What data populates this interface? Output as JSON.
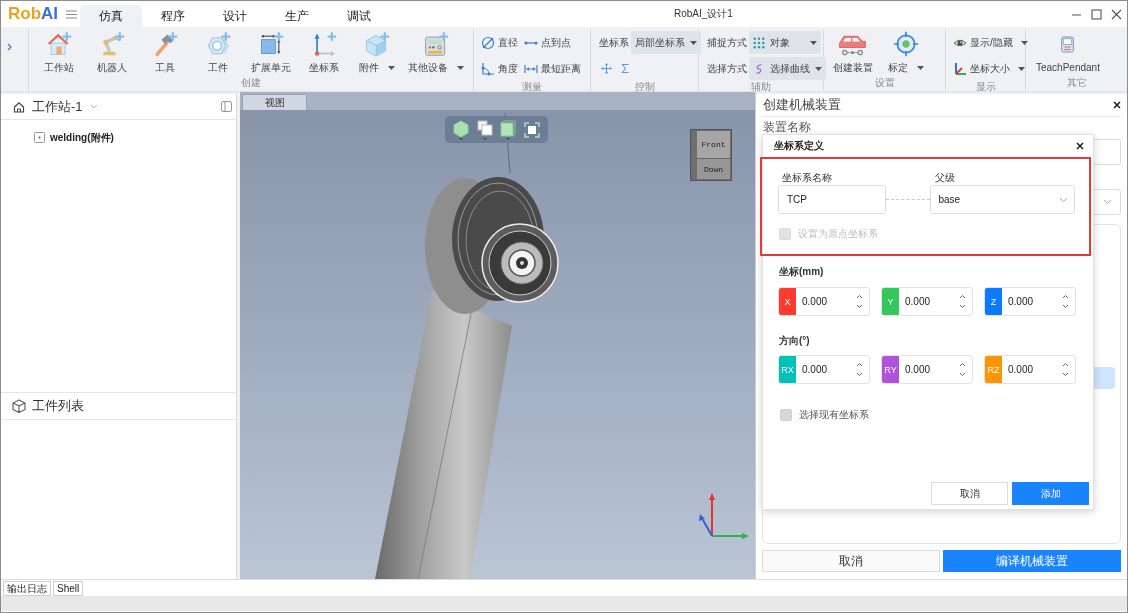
{
  "logo": {
    "parts": [
      {
        "text": "Rob",
        "color": "#e8a21c"
      },
      {
        "text": "AI",
        "color": "#3a70d6"
      }
    ]
  },
  "tabs": [
    {
      "label": "仿真",
      "selected": true
    },
    {
      "label": "程序",
      "selected": false
    },
    {
      "label": "设计",
      "selected": false
    },
    {
      "label": "生产",
      "selected": false
    },
    {
      "label": "调试",
      "selected": false
    }
  ],
  "window": {
    "title": "RobAI_设计1"
  },
  "ribbon": {
    "groups": [
      {
        "label": "创建",
        "kind": "row",
        "items": [
          {
            "kind": "large",
            "label": "工作站",
            "dropdown": false
          },
          {
            "kind": "large",
            "label": "机器人",
            "dropdown": false
          },
          {
            "kind": "large",
            "label": "工具",
            "dropdown": false
          },
          {
            "kind": "large",
            "label": "工件",
            "dropdown": false
          },
          {
            "kind": "large",
            "label": "扩展单元",
            "dropdown": false
          },
          {
            "kind": "large",
            "label": "坐标系",
            "dropdown": false
          },
          {
            "kind": "large",
            "label": "附件",
            "dropdown": true
          },
          {
            "kind": "large",
            "label": "其他设备",
            "dropdown": true
          }
        ]
      },
      {
        "label": "测量",
        "kind": "grid",
        "items": [
          {
            "kind": "small",
            "label": "直径",
            "dropdown": false
          },
          {
            "kind": "small",
            "label": "点到点",
            "dropdown": false
          },
          {
            "kind": "small",
            "label": "角度",
            "dropdown": false
          },
          {
            "kind": "small",
            "label": "最短距离",
            "dropdown": false
          }
        ]
      },
      {
        "label": "控制",
        "kind": "grid",
        "items": [
          {
            "kind": "combo",
            "label": "坐标系",
            "value": "局部坐标系"
          },
          {
            "kind": "tools"
          }
        ]
      },
      {
        "label": "辅助",
        "kind": "grid",
        "items": [
          {
            "kind": "combo",
            "label": "捕捉方式",
            "value": "对象"
          },
          {
            "kind": "combo",
            "label": "选择方式",
            "value": "选择曲线"
          }
        ]
      },
      {
        "label": "设置",
        "kind": "row",
        "items": [
          {
            "kind": "large",
            "label": "创建装置",
            "dropdown": false
          },
          {
            "kind": "large",
            "label": "标定",
            "dropdown": true
          }
        ]
      },
      {
        "label": "显示",
        "kind": "grid",
        "items": [
          {
            "kind": "small",
            "label": "显示/隐藏",
            "dropdown": true
          },
          {
            "kind": "small",
            "label": "坐标大小",
            "dropdown": true
          }
        ]
      },
      {
        "label": "其它",
        "kind": "row",
        "items": [
          {
            "kind": "large",
            "label": "TeachPendant",
            "dropdown": false
          }
        ]
      }
    ]
  },
  "left_panel": {
    "station": {
      "title": "工作站-1"
    },
    "tree": [
      {
        "label": "welding(附件)"
      }
    ],
    "workpieces": {
      "title": "工件列表"
    }
  },
  "viewport": {
    "tabs": [
      {
        "label": "视图",
        "selected": true
      }
    ],
    "view_cube": {
      "faces": [
        "Front",
        "Down"
      ]
    }
  },
  "right_panel": {
    "title": "创建机械装置",
    "name_label": "装置名称",
    "buttons": [
      {
        "label": "取消",
        "primary": false
      },
      {
        "label": "编译机械装置",
        "primary": true
      }
    ]
  },
  "dialog": {
    "title": "坐标系定义",
    "name_section": {
      "highlighted": true,
      "name_label": "坐标系名称",
      "name_value": "TCP",
      "parent_label": "父级",
      "parent_value": "base",
      "origin_option": {
        "label": "设置为原点坐标系",
        "checked": false,
        "disabled": true
      }
    },
    "position": {
      "label": "坐标(mm)",
      "fields": [
        {
          "axis": "X",
          "value": "0.000",
          "color": "#ff3b30"
        },
        {
          "axis": "Y",
          "value": "0.000",
          "color": "#34c759"
        },
        {
          "axis": "Z",
          "value": "0.000",
          "color": "#0a7aff"
        }
      ]
    },
    "orientation": {
      "label": "方向(°)",
      "fields": [
        {
          "axis": "RX",
          "value": "0.000",
          "color": "#00c2b8"
        },
        {
          "axis": "RY",
          "value": "0.000",
          "color": "#af52de"
        },
        {
          "axis": "RZ",
          "value": "0.000",
          "color": "#ff9500"
        }
      ]
    },
    "existing_option": {
      "label": "选择现有坐标系",
      "checked": false,
      "disabled": false
    },
    "buttons": [
      {
        "label": "取消",
        "primary": false
      },
      {
        "label": "添加",
        "primary": true
      }
    ]
  },
  "bottom_tabs": [
    "输出日志",
    "Shell"
  ]
}
